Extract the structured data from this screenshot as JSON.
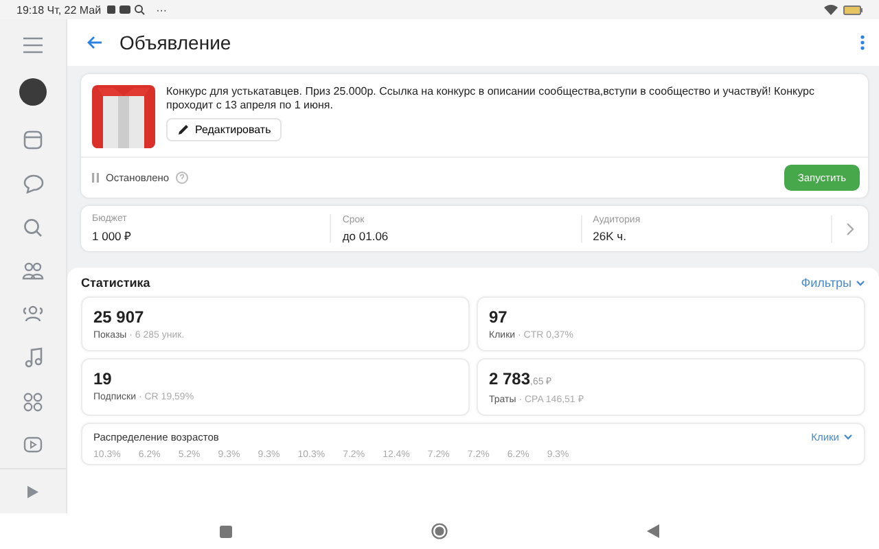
{
  "status_bar": {
    "time": "19:18 Чт, 22 Май",
    "more": "···"
  },
  "header": {
    "title": "Объявление"
  },
  "ad": {
    "text": "Конкурс для устькатавцев. Приз 25.000р. Ссылка на конкурс в описании сообщества,вступи в сообщество и участвуй! Конкурс проходит с 13 апреля по 1 июня.",
    "edit_button": "Редактировать",
    "status": "Остановлено",
    "launch_button": "Запустить"
  },
  "summary": [
    {
      "label": "Бюджет",
      "value": "1 000 ₽"
    },
    {
      "label": "Срок",
      "value": "до 01.06"
    },
    {
      "label": "Аудитория",
      "value": "26K ч."
    }
  ],
  "stats": {
    "title": "Статистика",
    "filter": "Фильтры",
    "cards": [
      {
        "value": "25 907",
        "label": "Показы",
        "note": "· 6 285 уник."
      },
      {
        "value": "97",
        "label": "Клики",
        "note": "· CTR 0,37%"
      },
      {
        "value": "19",
        "label": "Подписки",
        "note": "· CR 19,59%"
      },
      {
        "value": "2 783",
        "value_extra": ",65 ₽",
        "label": "Траты",
        "note": "· CPA 146,51 ₽"
      }
    ]
  },
  "age": {
    "title": "Распределение возрастов",
    "metric": "Клики",
    "percentages": [
      "10.3%",
      "6.2%",
      "5.2%",
      "9.3%",
      "9.3%",
      "10.3%",
      "7.2%",
      "12.4%",
      "7.2%",
      "7.2%",
      "6.2%",
      "9.3%"
    ]
  }
}
